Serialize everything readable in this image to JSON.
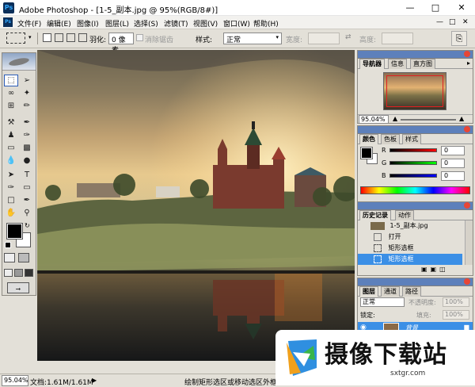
{
  "window": {
    "title": "Adobe Photoshop - [1-5_副本.jpg @ 95%(RGB/8#)]",
    "app_badge": "Ps"
  },
  "menu": [
    "文件(F)",
    "编辑(E)",
    "图像(I)",
    "图层(L)",
    "选择(S)",
    "滤镜(T)",
    "视图(V)",
    "窗口(W)",
    "帮助(H)"
  ],
  "options": {
    "feather_label": "羽化:",
    "feather_value": "0 像素",
    "antialias_label": "消除锯齿",
    "style_label": "样式:",
    "style_value": "正常",
    "width_label": "宽度:",
    "height_label": "高度:"
  },
  "navigator": {
    "tabs": [
      "导航器",
      "信息",
      "直方图"
    ],
    "zoom": "95.04%"
  },
  "color": {
    "tabs": [
      "颜色",
      "色板",
      "样式"
    ],
    "r_label": "R",
    "g_label": "G",
    "b_label": "B",
    "r": "0",
    "g": "0",
    "b": "0"
  },
  "history": {
    "tabs": [
      "历史记录",
      "动作"
    ],
    "snapshot": "1-5_副本.jpg",
    "items": [
      "打开",
      "矩形选框",
      "矩形选框"
    ]
  },
  "layers": {
    "tabs": [
      "图层",
      "通道",
      "路径"
    ],
    "blend_mode": "正常",
    "opacity_label": "不透明度:",
    "opacity_value": "100%",
    "lock_label": "锁定:",
    "fill_label": "填充:",
    "fill_value": "100%",
    "layer_name": "背景"
  },
  "status": {
    "zoom": "95.04%",
    "doc": "文档:1.61M/1.61M",
    "hint": "绘制矩形选区或移动选区外框。要用附"
  },
  "watermark": {
    "text": "摄像下载站",
    "url": "sxtgr.com"
  },
  "colors": {
    "highlight": "#3b8fe6",
    "panel_header": "#5d80bb"
  }
}
